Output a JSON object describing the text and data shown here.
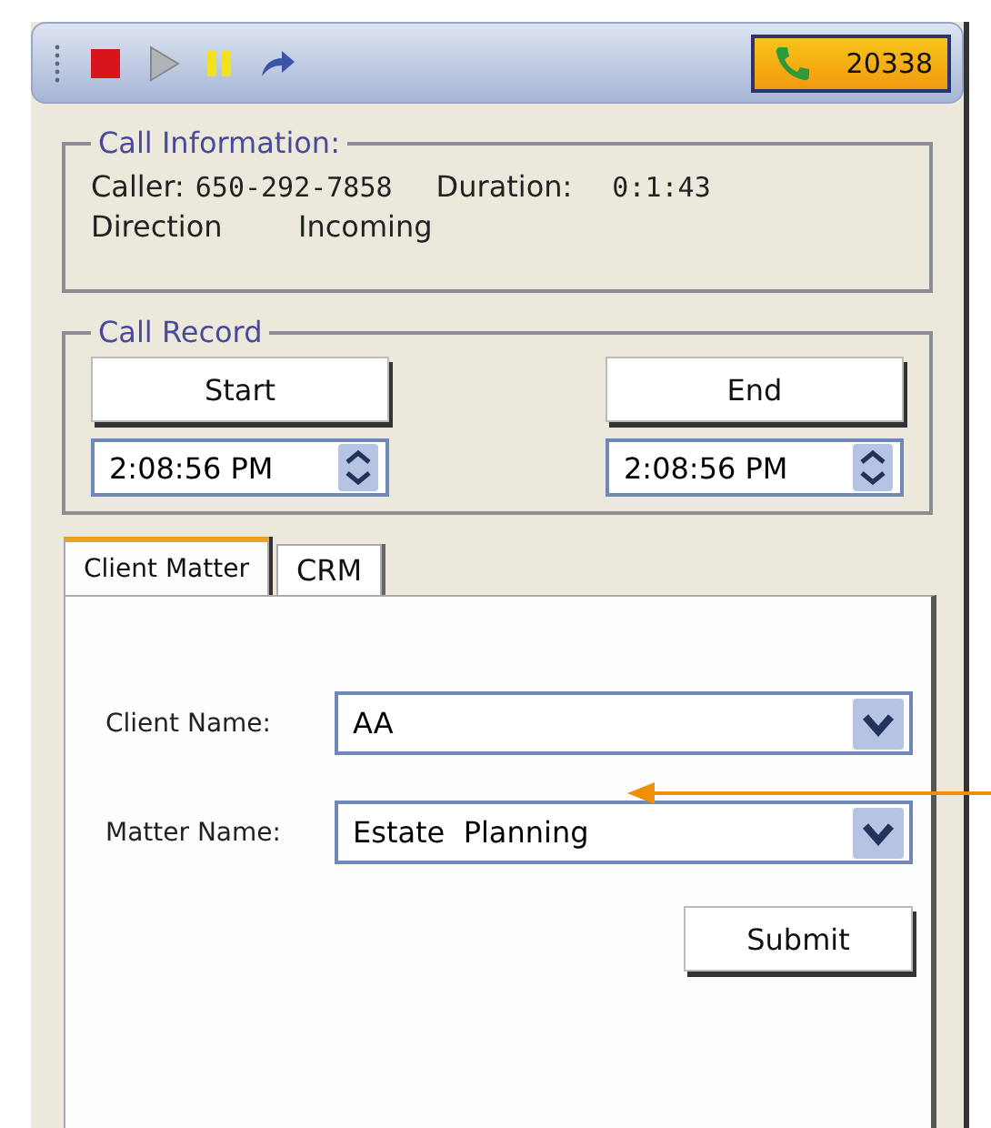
{
  "toolbar": {
    "buttons": [
      {
        "kind": "stop",
        "disabled": false
      },
      {
        "kind": "play",
        "disabled": true
      },
      {
        "kind": "pause",
        "disabled": false
      },
      {
        "kind": "forward",
        "disabled": false
      }
    ],
    "extension": "20338"
  },
  "call_information": {
    "title": "Call Information:",
    "fields": [
      {
        "label": "Caller:",
        "value": "650-292-7858"
      },
      {
        "label": "Duration:",
        "value": "0:1:43"
      },
      {
        "label": "Direction",
        "value": "Incoming"
      }
    ]
  },
  "call_record": {
    "title": "Call Record",
    "columns": [
      {
        "button": "Start",
        "time": "2:08:56 PM"
      },
      {
        "button": "End",
        "time": "2:08:56 PM"
      }
    ]
  },
  "tabs": [
    {
      "label": "Client Matter",
      "selected": true
    },
    {
      "label": "CRM",
      "selected": false
    }
  ],
  "form": {
    "fields": [
      {
        "label": "Client Name:",
        "value": "AA"
      },
      {
        "label": "Matter Name:",
        "value": "Estate  Planning"
      }
    ],
    "submit": "Submit"
  }
}
